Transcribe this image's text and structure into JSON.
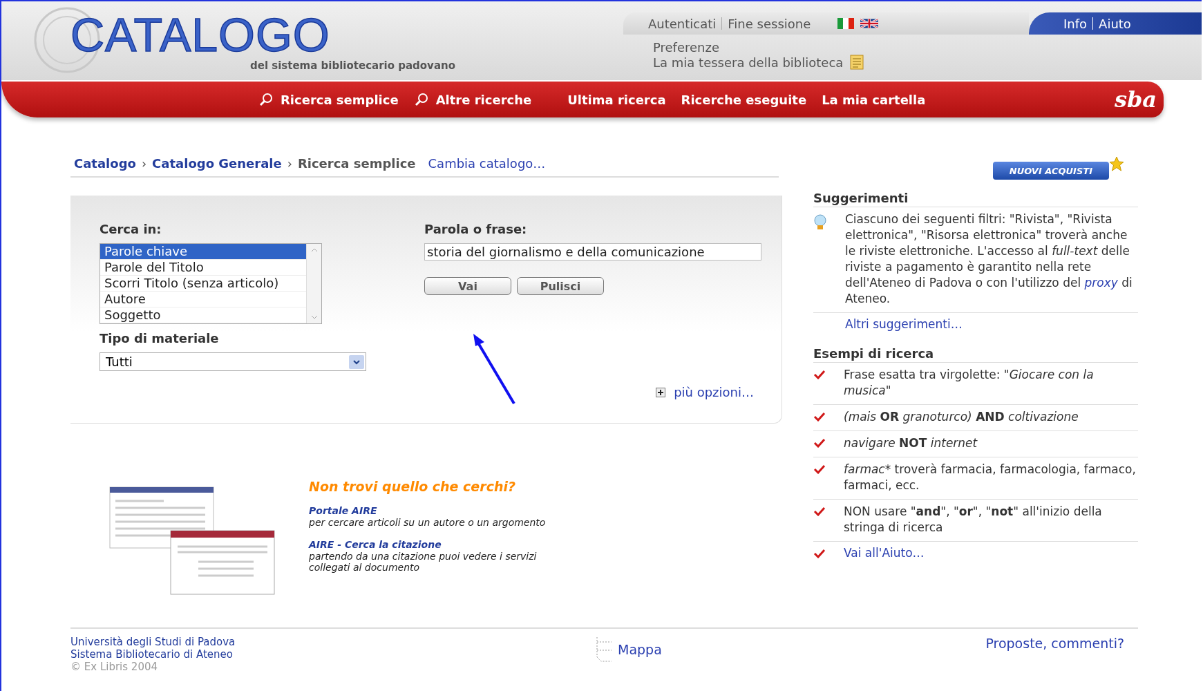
{
  "header": {
    "logo_title": "CATALOGO",
    "logo_subtitle": "del sistema bibliotecario padovano",
    "session_links": [
      "Autenticati",
      "Fine sessione"
    ],
    "help_links": [
      "Info",
      "Aiuto"
    ],
    "user_links": [
      "Preferenze",
      "La mia tessera della biblioteca"
    ],
    "brand": "sba"
  },
  "nav": [
    {
      "label": "Ricerca semplice",
      "kind": "search"
    },
    {
      "label": "Altre ricerche",
      "kind": "search"
    },
    {
      "label": "Ultima ricerca",
      "kind": "plain"
    },
    {
      "label": "Ricerche eseguite",
      "kind": "plain"
    },
    {
      "label": "La mia cartella",
      "kind": "plain"
    }
  ],
  "breadcrumb": {
    "items": [
      "Catalogo",
      "Catalogo Generale"
    ],
    "separator": "›",
    "current": "Ricerca semplice",
    "change_link": "Cambia catalogo…"
  },
  "new_acquisitions": "NUOVI ACQUISTI",
  "search": {
    "scope_label": "Cerca in:",
    "scopes": [
      {
        "label": "Parole chiave",
        "selected": true
      },
      {
        "label": "Parole del Titolo",
        "selected": false
      },
      {
        "label": "Scorri Titolo (senza articolo)",
        "selected": false
      },
      {
        "label": "Autore",
        "selected": false
      },
      {
        "label": "Soggetto",
        "selected": false
      }
    ],
    "material_label": "Tipo di materiale",
    "material_value": "Tutti",
    "query_label": "Parola o frase:",
    "query": "storia del giornalismo e della comunicazione",
    "buttons": [
      "Vai",
      "Pulisci"
    ],
    "more_options": "più opzioni…"
  },
  "promo": {
    "heading": "Non trovi quello che cerchi?",
    "links": [
      {
        "title": "Portale AIRE",
        "description": "per cercare articoli su un autore o un argomento"
      },
      {
        "title": "AIRE - Cerca la citazione",
        "description": "partendo da una citazione puoi vedere i servizi collegati al documento"
      }
    ]
  },
  "suggestions": {
    "heading": "Suggerimenti",
    "tip": "Ciascuno dei seguenti filtri: \"Rivista\", \"Rivista elettronica\", \"Risorsa elettronica\" troverà anche le riviste elettroniche. L'accesso al *full-text* delle riviste a pagamento è garantito nella rete dell'Ateneo di Padova o con l'utilizzo del",
    "tip_link": "proxy",
    "tip_after": "di Ateneo.",
    "more": "Altri suggerimenti…"
  },
  "examples": {
    "heading": "Esempi di ricerca",
    "items": [
      {
        "kind": "text",
        "text": "Frase esatta tra virgolette: *\"Giocare con la musica\"*"
      },
      {
        "kind": "text",
        "text": "*(mais* **OR** *granoturco)* **AND** *coltivazione*"
      },
      {
        "kind": "text",
        "text": "*navigare* **NOT** *internet*"
      },
      {
        "kind": "text",
        "lead": "farmac*",
        "text": " troverà farmacia, farmacologia, farmaco, farmaci, ecc."
      },
      {
        "kind": "text",
        "text": "NON usare \"**and**\", \"**or**\", \"**not**\" all'inizio della stringa di ricerca"
      },
      {
        "kind": "link",
        "text": "Vai all'Aiuto…"
      }
    ]
  },
  "footer": {
    "org_links": [
      "Università degli Studi di Padova",
      "Sistema Bibliotecario di Ateneo"
    ],
    "copyright": "© Ex Libris 2004",
    "map": "Mappa",
    "feedback": "Proposte, commenti?"
  }
}
